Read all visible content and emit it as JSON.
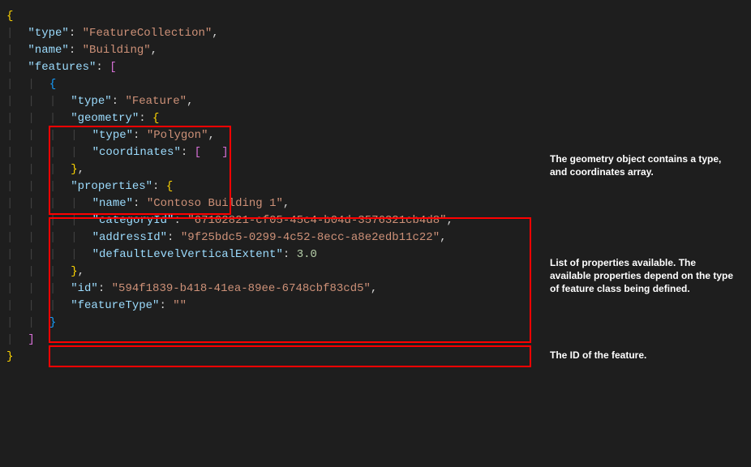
{
  "code": {
    "l0_brace": "{",
    "l1_key": "\"type\"",
    "l1_colon": ": ",
    "l1_val": "\"FeatureCollection\"",
    "l1_comma": ",",
    "l2_key": "\"name\"",
    "l2_colon": ": ",
    "l2_val": "\"Building\"",
    "l2_comma": ",",
    "l3_key": "\"features\"",
    "l3_colon": ": ",
    "l3_bracket": "[",
    "l4_brace": "{",
    "l5_key": "\"type\"",
    "l5_colon": ": ",
    "l5_val": "\"Feature\"",
    "l5_comma": ",",
    "l6_key": "\"geometry\"",
    "l6_colon": ": ",
    "l6_brace": "{",
    "l7_key": "\"type\"",
    "l7_colon": ": ",
    "l7_val": "\"Polygon\"",
    "l7_comma": ",",
    "l8_key": "\"coordinates\"",
    "l8_colon": ": ",
    "l8_open": "[",
    "l8_space": "   ",
    "l8_close": "]",
    "l9_brace": "}",
    "l9_comma": ",",
    "l10_key": "\"properties\"",
    "l10_colon": ": ",
    "l10_brace": "{",
    "l11_key": "\"name\"",
    "l11_colon": ": ",
    "l11_val": "\"Contoso Building 1\"",
    "l11_comma": ",",
    "l12_key": "\"categoryId\"",
    "l12_colon": ": ",
    "l12_val": "\"67102821-cf05-45c4-b04d-3576321cb4d8\"",
    "l12_comma": ",",
    "l13_key": "\"addressId\"",
    "l13_colon": ": ",
    "l13_val": "\"9f25bdc5-0299-4c52-8ecc-a8e2edb11c22\"",
    "l13_comma": ",",
    "l14_key": "\"defaultLevelVerticalExtent\"",
    "l14_colon": ": ",
    "l14_val": "3.0",
    "l15_brace": "}",
    "l15_comma": ",",
    "l16_key": "\"id\"",
    "l16_colon": ": ",
    "l16_val": "\"594f1839-b418-41ea-89ee-6748cbf83cd5\"",
    "l16_comma": ",",
    "l17_key": "\"featureType\"",
    "l17_colon": ": ",
    "l17_val": "\"\"",
    "l18_brace": "}",
    "l19_bracket": "]",
    "l20_brace": "}"
  },
  "annotations": {
    "geometry": "The geometry object contains a type, and coordinates array.",
    "properties": "List of properties available. The available properties depend on the type of feature class being defined.",
    "id": "The ID of the feature."
  }
}
